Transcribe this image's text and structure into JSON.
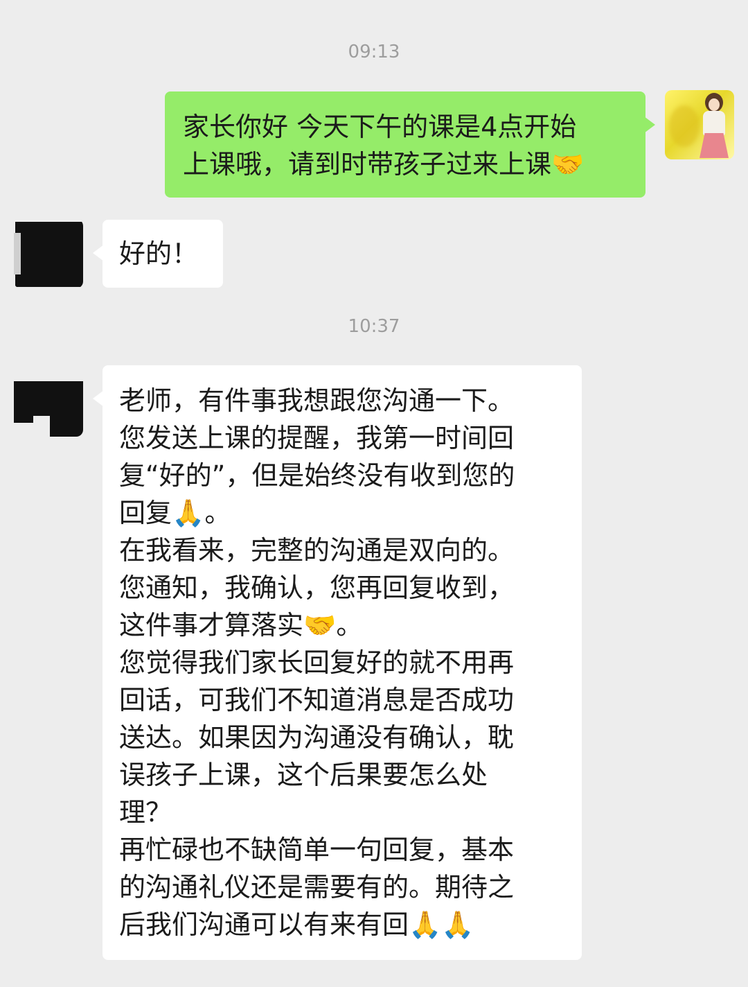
{
  "timestamps": [
    "09:13",
    "10:37"
  ],
  "messages": [
    {
      "sender": "self",
      "lines": [
        "家长你好 今天下午的课是4点开始",
        "上课哦，请到时带孩子过来上课🤝"
      ]
    },
    {
      "sender": "other",
      "lines": [
        "好的！"
      ]
    },
    {
      "sender": "other",
      "lines": [
        "老师，有件事我想跟您沟通一下。",
        "您发送上课的提醒，我第一时间回",
        "复“好的”，但是始终没有收到您的",
        "回复🙏。",
        "在我看来，完整的沟通是双向的。",
        "您通知，我确认，您再回复收到，",
        "这件事才算落实🤝。",
        "您觉得我们家长回复好的就不用再",
        "回话，可我们不知道消息是否成功",
        "送达。如果因为沟通没有确认，耽",
        "误孩子上课，这个后果要怎么处",
        "理？",
        "再忙碌也不缺简单一句回复，基本",
        "的沟通礼仪还是需要有的。期待之",
        "后我们沟通可以有来有回🙏🙏"
      ]
    }
  ],
  "avatars": {
    "self": "anime-girl-avatar",
    "other": "pixelated-avatar"
  },
  "colors": {
    "background": "#ededed",
    "self_bubble": "#95ec69",
    "other_bubble": "#ffffff",
    "timestamp": "#9d9d9d"
  }
}
